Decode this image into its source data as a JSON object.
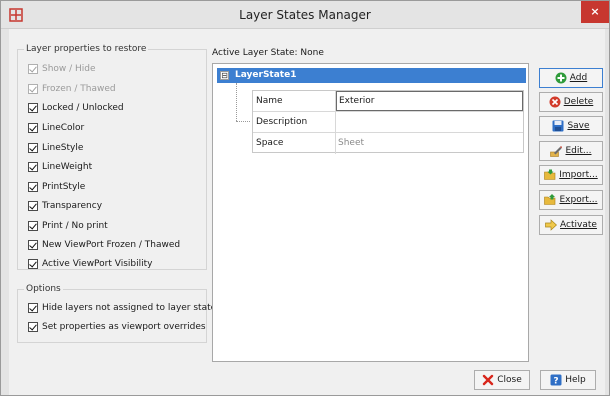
{
  "window": {
    "title": "Layer States Manager",
    "close_glyph": "×"
  },
  "restore_group": {
    "title": "Layer properties to restore",
    "items": [
      {
        "label": "Show / Hide",
        "checked": true,
        "enabled": false
      },
      {
        "label": "Frozen / Thawed",
        "checked": true,
        "enabled": false
      },
      {
        "label": "Locked / Unlocked",
        "checked": true,
        "enabled": true
      },
      {
        "label": "LineColor",
        "checked": true,
        "enabled": true
      },
      {
        "label": "LineStyle",
        "checked": true,
        "enabled": true
      },
      {
        "label": "LineWeight",
        "checked": true,
        "enabled": true
      },
      {
        "label": "PrintStyle",
        "checked": true,
        "enabled": true
      },
      {
        "label": "Transparency",
        "checked": true,
        "enabled": true
      },
      {
        "label": "Print / No print",
        "checked": true,
        "enabled": true
      },
      {
        "label": "New ViewPort Frozen / Thawed",
        "checked": true,
        "enabled": true
      },
      {
        "label": "Active ViewPort Visibility",
        "checked": true,
        "enabled": true
      }
    ]
  },
  "options_group": {
    "title": "Options",
    "items": [
      {
        "label": "Hide layers not assigned to layer state",
        "checked": true
      },
      {
        "label": "Set properties as viewport overrides",
        "checked": true
      }
    ]
  },
  "active_state": "Active Layer State:  None",
  "tree": {
    "expander": "⊟",
    "node": "LayerState1",
    "properties": [
      {
        "name": "Name",
        "value": "Exterior",
        "editing": true
      },
      {
        "name": "Description",
        "value": ""
      },
      {
        "name": "Space",
        "value": "Sheet",
        "muted": true
      }
    ]
  },
  "buttons": {
    "add": "Add",
    "delete": "Delete",
    "save": "Save",
    "edit": "Edit...",
    "import": "Import...",
    "export": "Export...",
    "activate": "Activate",
    "close": "Close",
    "help": "Help"
  },
  "colors": {
    "accent": "#3c7fd1",
    "close_red": "#c7372f",
    "add_green": "#2e9b3a",
    "delete_red": "#d23a2a",
    "save_blue": "#2f6fc6"
  }
}
